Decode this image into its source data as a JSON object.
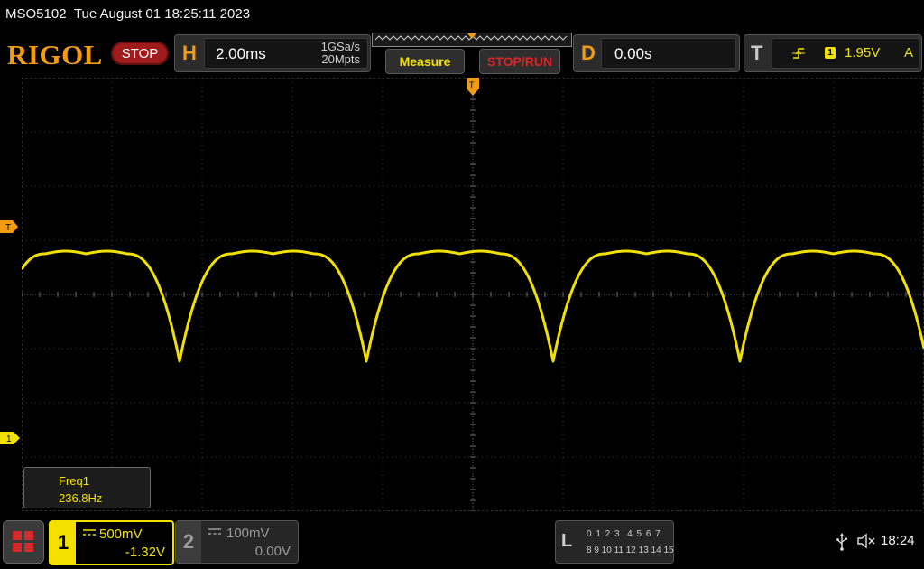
{
  "title_bar": {
    "model": "MSO5102",
    "datetime": "Tue August 01 18:25:11 2023"
  },
  "header": {
    "logo": "RIGOL",
    "run_state": "STOP",
    "horizontal": {
      "letter": "H",
      "timebase": "2.00ms",
      "sample_rate": "1GSa/s",
      "memory_depth": "20Mpts"
    },
    "measure_button": "Measure",
    "stop_run_button": "STOP/RUN",
    "delay": {
      "letter": "D",
      "value": "0.00s"
    },
    "trigger": {
      "letter": "T",
      "edge_icon": "rising-edge-icon",
      "channel": "1",
      "level": "1.95V",
      "mode": "A"
    }
  },
  "waveform": {
    "channel": "1",
    "color": "#f2e100",
    "grid_divisions": {
      "horizontal": 10,
      "vertical": 8
    },
    "trigger_marker_label": "T",
    "channel_marker_label": "1",
    "position_marker_label": "T"
  },
  "measurement": {
    "label": "Freq1",
    "value": "236.8Hz"
  },
  "bottom_bar": {
    "home_icon": "grid-menu-icon",
    "ch1": {
      "number": "1",
      "scale": "500mV",
      "offset": "-1.32V",
      "coupling_icon": "dc-coupling-icon"
    },
    "ch2": {
      "number": "2",
      "scale": "100mV",
      "offset": "0.00V",
      "coupling_icon": "dc-coupling-icon"
    },
    "logic": {
      "letter": "L",
      "row1": "0 1 2 3  4 5 6 7",
      "row2": "8 9 10 11 12 13 14 15"
    },
    "usb_icon": "usb-icon",
    "speaker_icon": "speaker-muted-icon",
    "clock": "18:24"
  },
  "colors": {
    "accent_orange": "#f39c12",
    "channel1_yellow": "#f2e100",
    "stop_red": "#a01b1b"
  }
}
